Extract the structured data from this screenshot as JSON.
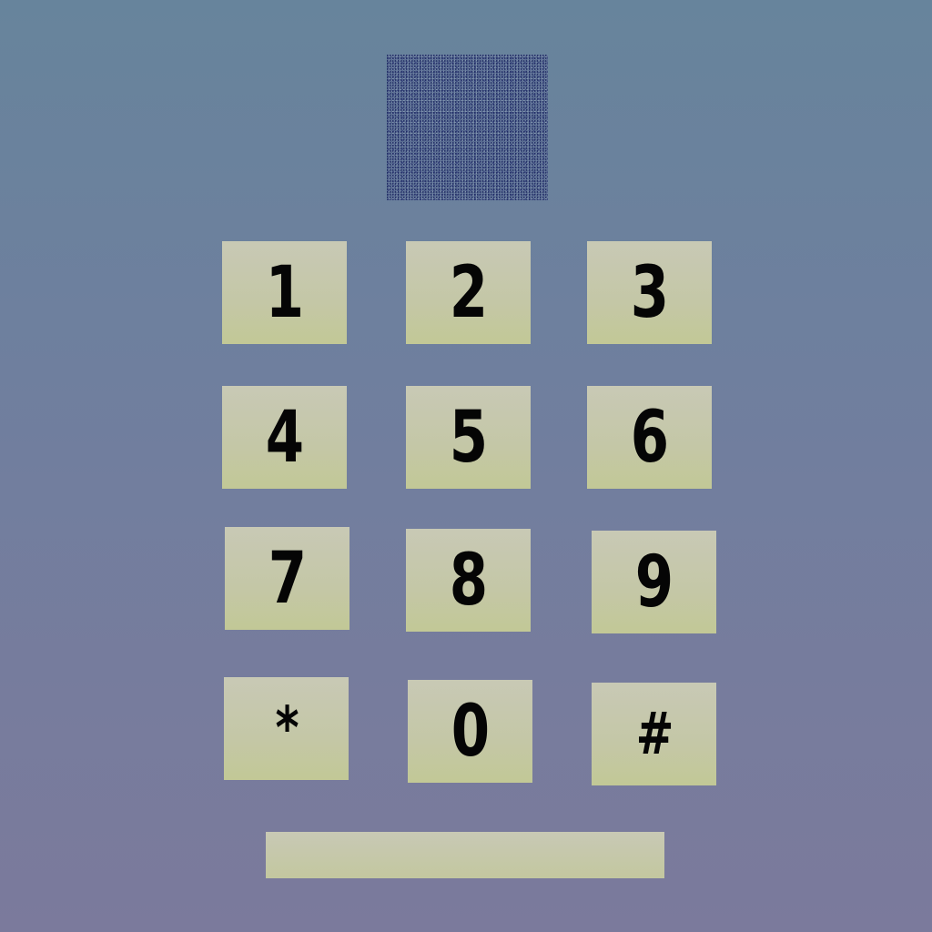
{
  "keypad": {
    "keys": [
      "1",
      "2",
      "3",
      "4",
      "5",
      "6",
      "7",
      "8",
      "9",
      "*",
      "0",
      "#"
    ]
  },
  "colors": {
    "background_top": "#67849c",
    "background_bottom": "#7b7a9c",
    "key_fill": "#c4c7a6",
    "key_text": "#050505"
  }
}
